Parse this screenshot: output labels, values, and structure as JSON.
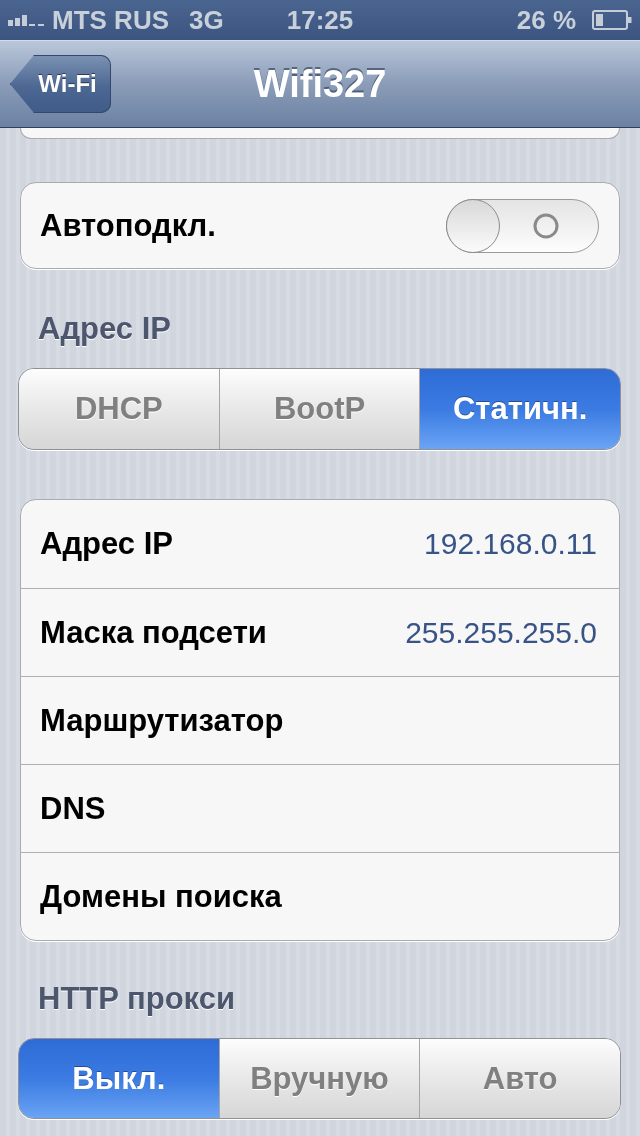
{
  "status_bar": {
    "carrier": "MTS RUS",
    "network": "3G",
    "time": "17:25",
    "battery": "26 %"
  },
  "nav_bar": {
    "back": "Wi-Fi",
    "title": "Wifi327"
  },
  "auto_join": {
    "label": "Автоподкл.",
    "on": false
  },
  "ip_section": {
    "header": "Адрес IP",
    "modes": [
      {
        "label": "DHCP",
        "selected": false
      },
      {
        "label": "BootP",
        "selected": false
      },
      {
        "label": "Статичн.",
        "selected": true
      }
    ]
  },
  "ip_fields": [
    {
      "label": "Адрес IP",
      "value": "192.168.0.11"
    },
    {
      "label": "Маска подсети",
      "value": "255.255.255.0"
    },
    {
      "label": "Маршрутизатор"
    },
    {
      "label": "DNS"
    },
    {
      "label": "Домены поиска"
    }
  ],
  "proxy_section": {
    "header": "HTTP прокси",
    "modes": [
      {
        "label": "Выкл.",
        "selected": true
      },
      {
        "label": "Вручную",
        "selected": false
      },
      {
        "label": "Авто",
        "selected": false
      }
    ]
  }
}
